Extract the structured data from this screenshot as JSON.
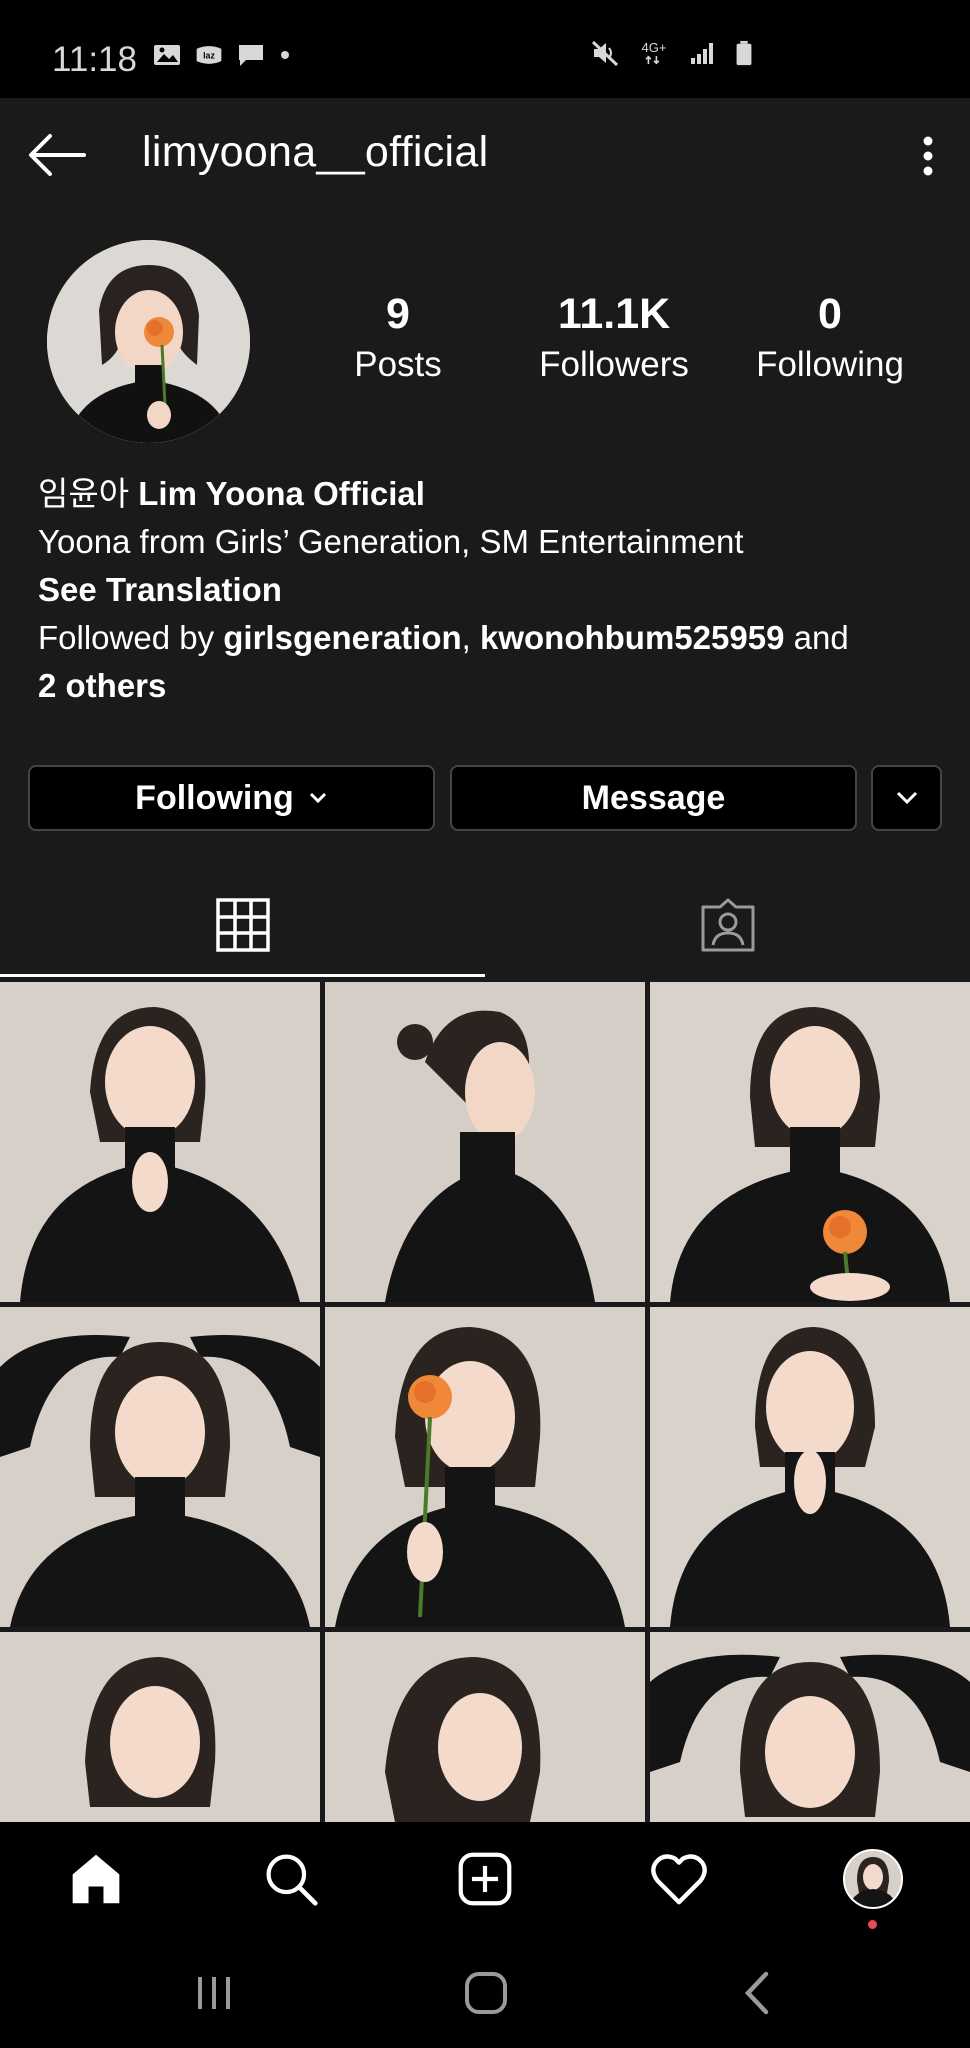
{
  "status_bar": {
    "time": "11:18",
    "network_label": "4G+",
    "left_icons": [
      "image-icon",
      "laz-app-icon",
      "chat-icon",
      "dot-icon"
    ],
    "right_icons": [
      "mute-icon",
      "network-4g-icon",
      "signal-icon",
      "battery-icon"
    ]
  },
  "header": {
    "username": "limyoona__official",
    "back_icon": "arrow-left-icon",
    "more_icon": "more-vertical-icon"
  },
  "profile": {
    "stats": [
      {
        "value": "9",
        "label": "Posts"
      },
      {
        "value": "11.1K",
        "label": "Followers"
      },
      {
        "value": "0",
        "label": "Following"
      }
    ],
    "name_korean": "임윤아",
    "name_english": "Lim Yoona Official",
    "bio_line": "Yoona from Girls’ Generation, SM Entertainment",
    "see_translation": "See Translation",
    "followed_by_prefix": "Followed by",
    "followed_by_user1": "girlsgeneration",
    "followed_by_sep": ",",
    "followed_by_user2": "kwonohbum525959",
    "followed_by_and": "and",
    "followed_by_others": "2 others"
  },
  "actions": {
    "following_label": "Following",
    "message_label": "Message"
  },
  "tabs": [
    {
      "name": "grid",
      "icon": "grid-icon",
      "active": true
    },
    {
      "name": "tagged",
      "icon": "tagged-person-icon",
      "active": false
    }
  ],
  "posts": [
    {
      "pose": "hand-on-chin-smile"
    },
    {
      "pose": "side-profile-bun"
    },
    {
      "pose": "holding-orange-rose"
    },
    {
      "pose": "hands-on-head"
    },
    {
      "pose": "rose-covering-face"
    },
    {
      "pose": "finger-on-lips"
    },
    {
      "pose": "smiling-tilt"
    },
    {
      "pose": "looking-down-yellow-flowers"
    },
    {
      "pose": "hands-on-head-pout"
    }
  ],
  "bottom_nav": {
    "items": [
      "home-icon",
      "search-icon",
      "add-post-icon",
      "activity-heart-icon",
      "profile-avatar"
    ]
  },
  "colors": {
    "background": "#1a1a1a",
    "button_background": "#000000",
    "notification_dot": "#ed4956",
    "photo_wall": "#d4cec6",
    "rose": "#f0883a"
  }
}
